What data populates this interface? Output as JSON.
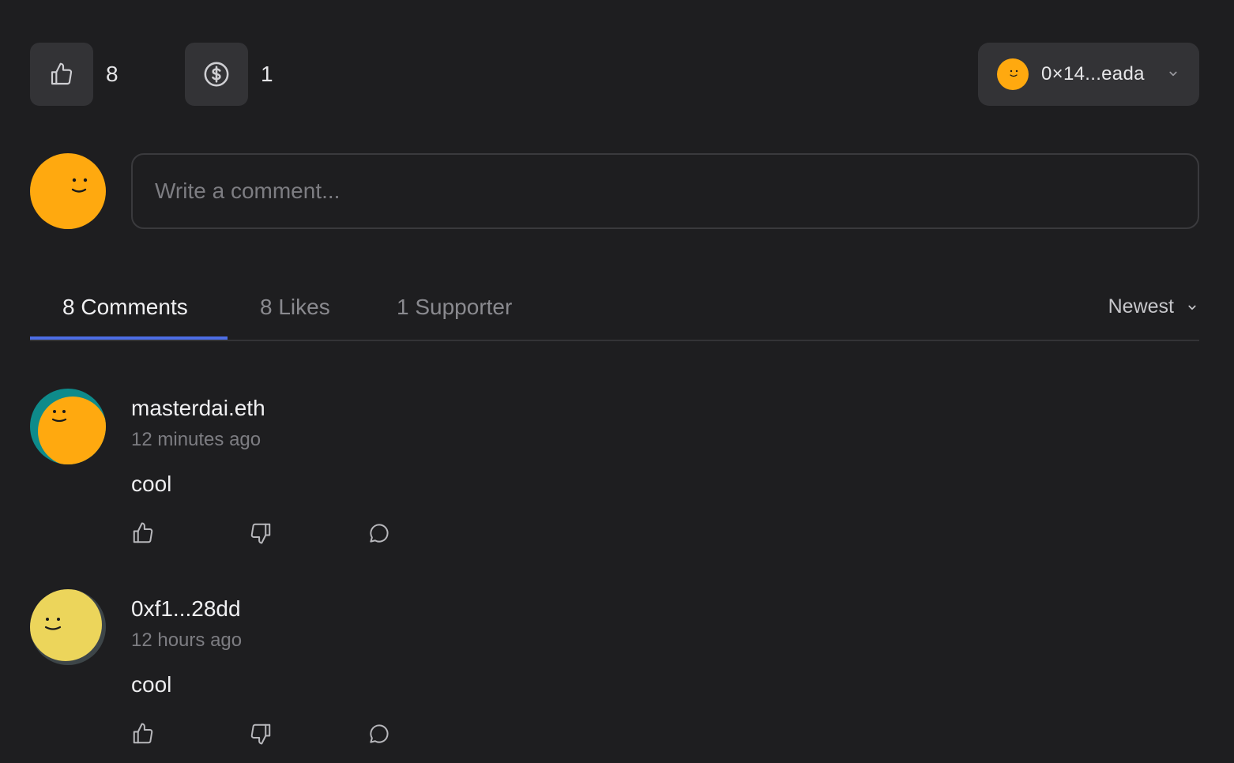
{
  "reactions": {
    "likes": {
      "icon": "thumbs-up-icon",
      "count": "8"
    },
    "support": {
      "icon": "dollar-circle-icon",
      "count": "1"
    }
  },
  "account": {
    "address": "0×14...eada",
    "icon": "chevron-down-icon"
  },
  "composer": {
    "placeholder": "Write a comment..."
  },
  "tabs": [
    {
      "label": "8 Comments",
      "active": true
    },
    {
      "label": "8 Likes",
      "active": false
    },
    {
      "label": "1 Supporter",
      "active": false
    }
  ],
  "sort": {
    "label": "Newest"
  },
  "comments": [
    {
      "author": "masterdai.eth",
      "time": "12 minutes ago",
      "body": "cool"
    },
    {
      "author": "0xf1...28dd",
      "time": "12 hours ago",
      "body": "cool"
    }
  ],
  "colors": {
    "background": "#1e1e20",
    "button": "#333336",
    "accent": "#4d6ee5",
    "avatar_orange": "#ffa90f",
    "avatar_teal": "#0e8b8b",
    "avatar_yellow": "#ecd55b"
  }
}
